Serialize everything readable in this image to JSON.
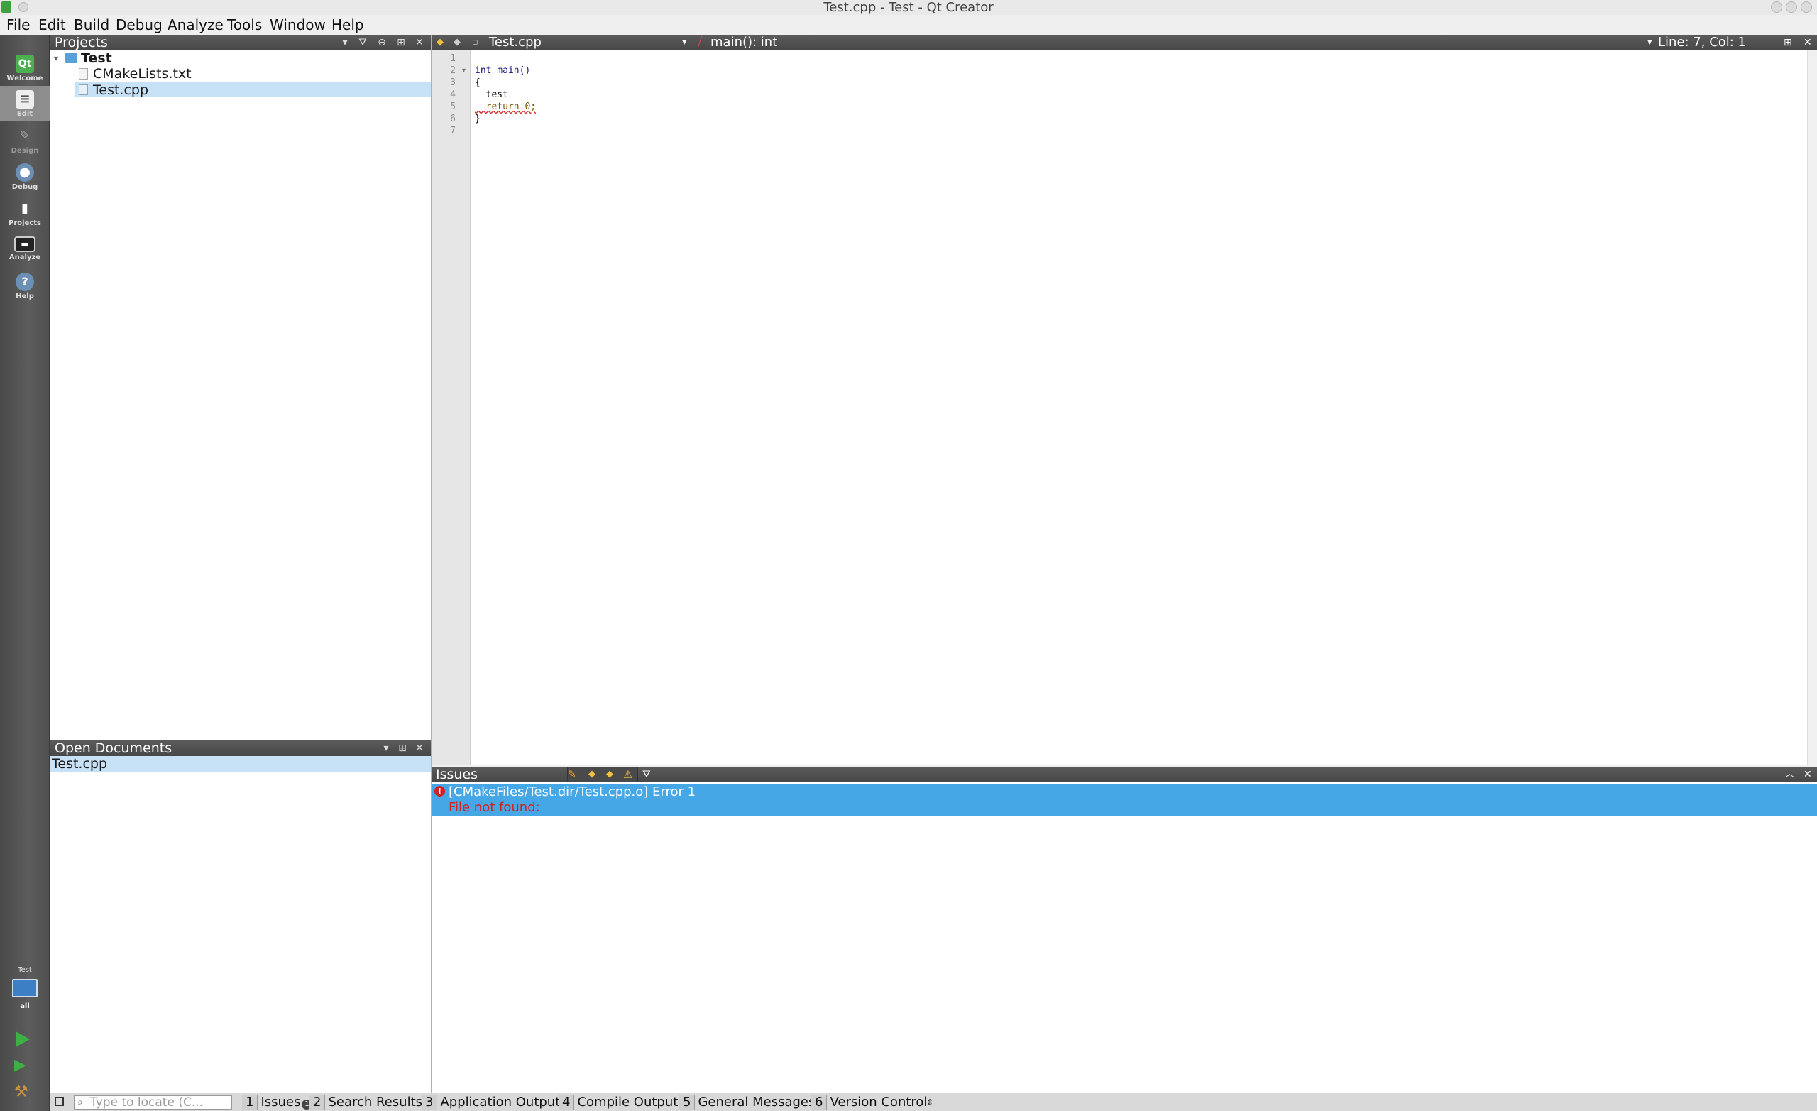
{
  "window": {
    "title": "Test.cpp - Test - Qt Creator"
  },
  "menu": [
    "File",
    "Edit",
    "Build",
    "Debug",
    "Analyze",
    "Tools",
    "Window",
    "Help"
  ],
  "modes": [
    {
      "label": "Welcome",
      "icon": "qt-logo-icon"
    },
    {
      "label": "Edit",
      "icon": "edit-document-icon"
    },
    {
      "label": "Design",
      "icon": "design-pen-icon"
    },
    {
      "label": "Debug",
      "icon": "debug-bug-icon"
    },
    {
      "label": "Projects",
      "icon": "projects-wrench-icon"
    },
    {
      "label": "Analyze",
      "icon": "analyze-monitor-icon"
    },
    {
      "label": "Help",
      "icon": "help-question-icon"
    }
  ],
  "kit": {
    "project": "Test",
    "config": "all"
  },
  "projects": {
    "title": "Projects",
    "tree": [
      {
        "label": "Test",
        "icon": "folder-icon"
      },
      {
        "label": "CMakeLists.txt",
        "icon": "text-file-icon"
      },
      {
        "label": "Test.cpp",
        "icon": "cpp-file-icon"
      }
    ]
  },
  "open_documents": {
    "title": "Open Documents",
    "items": [
      "Test.cpp"
    ]
  },
  "editor": {
    "file": "Test.cpp",
    "symbol": "main(): int",
    "cursor": "Line: 7, Col: 1",
    "lines": [
      {
        "n": "1",
        "text": ""
      },
      {
        "n": "2",
        "text": "int main()"
      },
      {
        "n": "3",
        "text": "{"
      },
      {
        "n": "4",
        "text": "  test"
      },
      {
        "n": "5",
        "text": "  return 0;"
      },
      {
        "n": "6",
        "text": "}"
      },
      {
        "n": "7",
        "text": ""
      }
    ]
  },
  "issues": {
    "title": "Issues",
    "items": [
      {
        "message": "[CMakeFiles/Test.dir/Test.cpp.o] Error 1",
        "detail": "File not found:"
      }
    ]
  },
  "status": {
    "locator_placeholder": "Type to locate (C...",
    "tabs": [
      {
        "num": "1",
        "label": "Issues",
        "badge": "1"
      },
      {
        "num": "2",
        "label": "Search Results"
      },
      {
        "num": "3",
        "label": "Application Output"
      },
      {
        "num": "4",
        "label": "Compile Output"
      },
      {
        "num": "5",
        "label": "General Messages"
      },
      {
        "num": "6",
        "label": "Version Control"
      }
    ]
  }
}
